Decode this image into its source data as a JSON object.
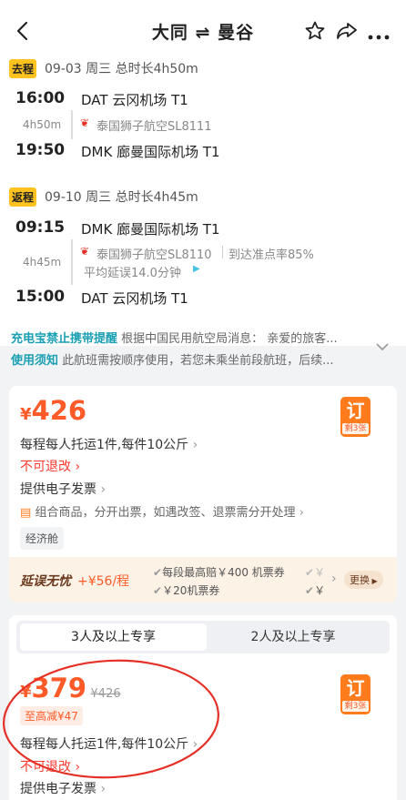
{
  "header": {
    "title": "大同 ⇌ 曼谷"
  },
  "outbound": {
    "tag": "去程",
    "summary": "09-03 周三 总时长4h50m",
    "dep_time": "16:00",
    "dep_airport": "DAT 云冈机场 T1",
    "duration": "4h50m",
    "airline": "泰国狮子航空SL8111",
    "arr_time": "19:50",
    "arr_airport": "DMK 廊曼国际机场 T1"
  },
  "return": {
    "tag": "返程",
    "summary": "09-10 周三 总时长4h45m",
    "dep_time": "09:15",
    "dep_airport": "DMK 廊曼国际机场 T1",
    "duration": "4h45m",
    "airline": "泰国狮子航空SL8110",
    "ontime": "到达准点率85%",
    "delay": "平均延误14.0分钟",
    "arr_time": "15:00",
    "arr_airport": "DAT 云冈机场 T1"
  },
  "notices": [
    {
      "title": "充电宝禁止携带提醒",
      "text": "根据中国民用航空局消息： 亲爱的旅客..."
    },
    {
      "title": "使用须知",
      "text": "此航班需按顺序使用，若您未乘坐前段航班，后续..."
    }
  ],
  "offer1": {
    "currency": "¥",
    "price": "426",
    "baggage": "每程每人托运1件,每件10公斤",
    "refund": "不可退改",
    "invoice": "提供电子发票",
    "combo": "组合商品，分开出票，如遇改签、退票需分开处理",
    "cabin": "经济舱",
    "buy_label": "订",
    "remain": "剩3张"
  },
  "delay_ins": {
    "title": "延误无忧",
    "price": "+¥56/程",
    "item1": "每段最高赔￥400 机票券",
    "item2": "￥20机票券",
    "item3": "￥",
    "item4": "￥",
    "change": "更换"
  },
  "tabs": [
    {
      "label": "3人及以上专享"
    },
    {
      "label": "2人及以上专享"
    }
  ],
  "offer2": {
    "currency": "¥",
    "price": "379",
    "orig_price": "¥426",
    "discount": "至高减¥47",
    "baggage": "每程每人托运1件,每件10公斤",
    "refund": "不可退改",
    "invoice": "提供电子发票",
    "buy_label": "订",
    "remain": "剩3张"
  },
  "colors": {
    "accent": "#ff5a28",
    "tag": "#ffc21f",
    "annotation": "#e53027"
  }
}
